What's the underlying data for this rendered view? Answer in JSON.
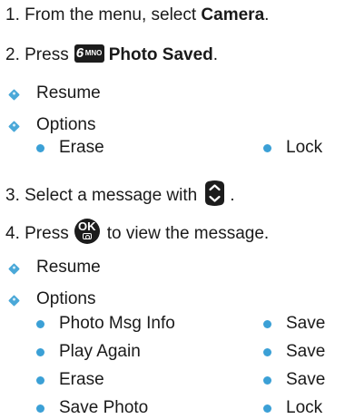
{
  "steps": [
    {
      "prefix": "1. From the menu, select ",
      "bold": "Camera",
      "suffix": "."
    },
    {
      "prefix": "2. Press",
      "key_digit": "6",
      "key_letters": "MNO",
      "bold": "Photo Saved",
      "suffix": "."
    },
    {
      "text": "3. Select a message with",
      "suffix": "."
    },
    {
      "prefix": "4. Press",
      "key_label": "OK",
      "suffix": "to view the message."
    }
  ],
  "section1": {
    "resume": "Resume",
    "options": "Options",
    "sub_left": [
      "Erase"
    ],
    "sub_right": [
      "Lock"
    ]
  },
  "section2": {
    "resume": "Resume",
    "options": "Options",
    "sub_left": [
      "Photo Msg Info",
      "Play Again",
      "Erase",
      "Save Photo"
    ],
    "sub_right": [
      "Save",
      "Save",
      "Save",
      "Lock"
    ]
  },
  "colors": {
    "bullet": "#3ba0d6",
    "diamond": "#4aa8d8",
    "text": "#1a1a1a"
  },
  "icons": {
    "key6": "6-mno-key-icon",
    "nav": "navigation-key-icon",
    "ok": "ok-camera-key-icon"
  }
}
